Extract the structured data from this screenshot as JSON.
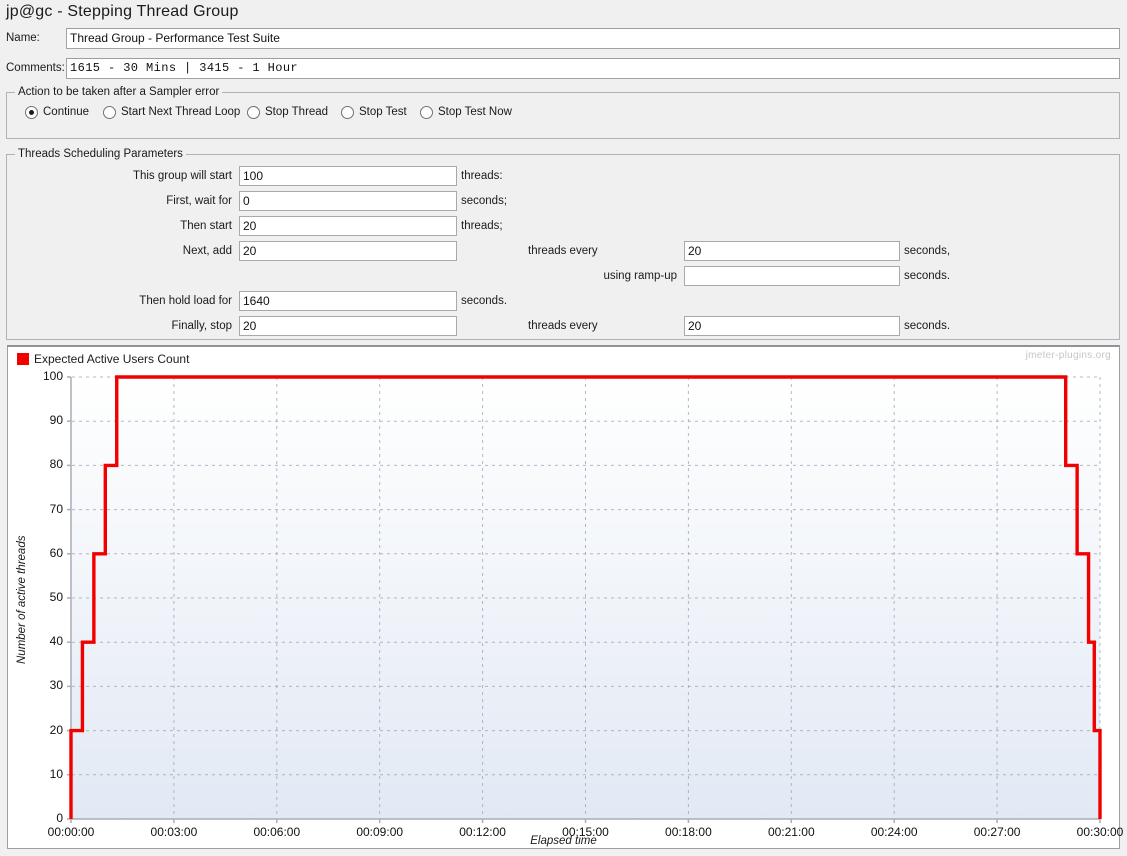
{
  "window": {
    "title": "jp@gc - Stepping Thread Group"
  },
  "name_field": {
    "label": "Name:",
    "value": "Thread Group - Performance Test Suite",
    "placeholder": ""
  },
  "comments_field": {
    "label": "Comments:",
    "value": "1615 - 30 Mins | 3415 - 1 Hour",
    "placeholder": ""
  },
  "sampler_error": {
    "group_title": "Action to be taken after a Sampler error",
    "options": [
      {
        "label": "Continue",
        "checked": true
      },
      {
        "label": "Start Next Thread Loop",
        "checked": false
      },
      {
        "label": "Stop Thread",
        "checked": false
      },
      {
        "label": "Stop Test",
        "checked": false
      },
      {
        "label": "Stop Test Now",
        "checked": false
      }
    ]
  },
  "scheduling": {
    "group_title": "Threads Scheduling Parameters",
    "rows": [
      {
        "label": "This group will start",
        "value": "100",
        "suffix": "threads:"
      },
      {
        "label": "First, wait for",
        "value": "0",
        "suffix": "seconds;"
      },
      {
        "label": "Then start",
        "value": "20",
        "suffix": "threads;"
      },
      {
        "label": "Next, add",
        "value": "20",
        "suffix": "threads every"
      },
      {
        "label": "Then hold load for",
        "value": "1640",
        "suffix": "seconds."
      },
      {
        "label": "Finally, stop",
        "value": "20",
        "suffix": "threads every"
      }
    ],
    "right_rows": [
      {
        "value": "20",
        "suffix": "seconds,"
      },
      {
        "label": "using ramp-up",
        "value": "",
        "suffix": "seconds."
      },
      {
        "value": "20",
        "suffix": "seconds."
      }
    ]
  },
  "chart": {
    "legend_label": "Expected Active Users Count",
    "watermark": "jmeter-plugins.org",
    "series_color": "#f20000"
  },
  "chart_data": {
    "type": "line",
    "title": "Expected Active Users Count",
    "xlabel": "Elapsed time",
    "ylabel": "Number of active threads",
    "xlim": [
      0,
      1800
    ],
    "ylim": [
      0,
      100
    ],
    "x_tick_labels": [
      "00:00:00",
      "00:03:00",
      "00:06:00",
      "00:09:00",
      "00:12:00",
      "00:15:00",
      "00:18:00",
      "00:21:00",
      "00:24:00",
      "00:27:00",
      "00:30:00"
    ],
    "x_tick_seconds": [
      0,
      180,
      360,
      540,
      720,
      900,
      1080,
      1260,
      1440,
      1620,
      1800
    ],
    "y_tick_labels": [
      "0",
      "10",
      "20",
      "30",
      "40",
      "50",
      "60",
      "70",
      "80",
      "90",
      "100"
    ],
    "y_tick_values": [
      0,
      10,
      20,
      30,
      40,
      50,
      60,
      70,
      80,
      90,
      100
    ],
    "grid": true,
    "legend_position": "top-left",
    "series": [
      {
        "name": "Expected Active Users Count",
        "color": "#f20000",
        "step": true,
        "points": [
          [
            0,
            0
          ],
          [
            0,
            20
          ],
          [
            20,
            20
          ],
          [
            20,
            40
          ],
          [
            40,
            40
          ],
          [
            40,
            60
          ],
          [
            60,
            60
          ],
          [
            60,
            80
          ],
          [
            80,
            80
          ],
          [
            80,
            100
          ],
          [
            100,
            100
          ],
          [
            1740,
            100
          ],
          [
            1740,
            80
          ],
          [
            1760,
            80
          ],
          [
            1760,
            60
          ],
          [
            1780,
            60
          ],
          [
            1780,
            40
          ],
          [
            1790,
            40
          ],
          [
            1790,
            20
          ],
          [
            1800,
            20
          ],
          [
            1800,
            0
          ]
        ]
      }
    ]
  }
}
